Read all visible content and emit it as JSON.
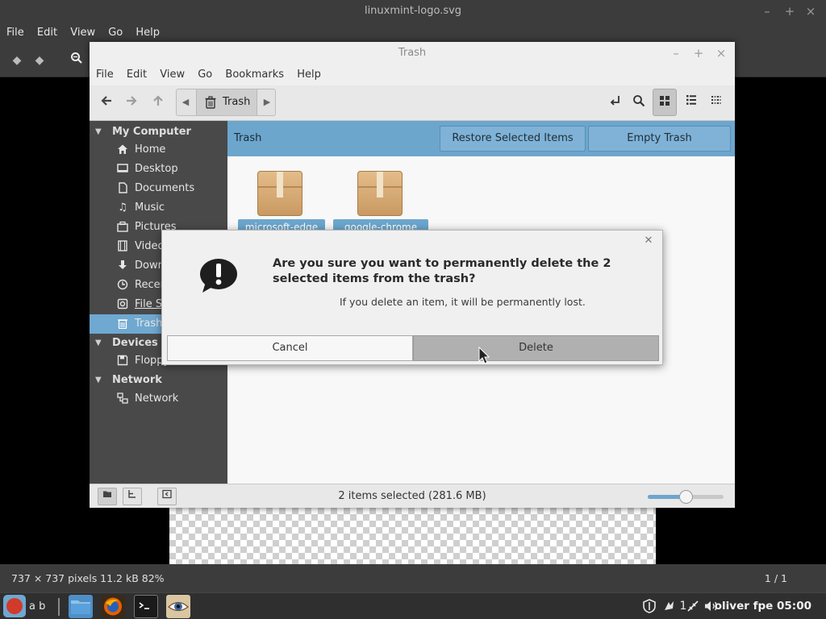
{
  "viewer": {
    "title": "linuxmint-logo.svg",
    "menu": [
      "File",
      "Edit",
      "View",
      "Go",
      "Help"
    ],
    "status_left": "737 × 737 pixels  11.2 kB   82%",
    "status_right": "1 / 1"
  },
  "nemo": {
    "title": "Trash",
    "menu": [
      "File",
      "Edit",
      "View",
      "Go",
      "Bookmarks",
      "Help"
    ],
    "path_crumb": "Trash",
    "sidebar": {
      "my_computer": "My Computer",
      "items": [
        "Home",
        "Desktop",
        "Documents",
        "Music",
        "Pictures",
        "Videos",
        "Downloads",
        "Recent",
        "File System",
        "Trash"
      ],
      "devices": "Devices",
      "device_items": [
        "Floppy Disk"
      ],
      "network": "Network",
      "network_items": [
        "Network"
      ]
    },
    "location_label": "Trash",
    "restore_button": "Restore Selected Items",
    "empty_button": "Empty Trash",
    "files": [
      "microsoft-edge",
      "google-chrome"
    ],
    "status_text": "2 items selected (281.6 MB)",
    "zoom_level": 0.5
  },
  "dialog": {
    "title": "Are you sure you want to permanently delete the 2 selected items from the trash?",
    "subtitle": "If you delete an item, it will be permanently lost.",
    "cancel_label": "Cancel",
    "delete_label": "Delete"
  },
  "taskbar": {
    "menu_text": "a b",
    "tray_updates": "1",
    "clock": "oliver fpe 05:00"
  },
  "colors": {
    "accent": "#6ca6cd",
    "sidebar_bg": "#494949",
    "panel_bg": "#2f2f2f"
  }
}
